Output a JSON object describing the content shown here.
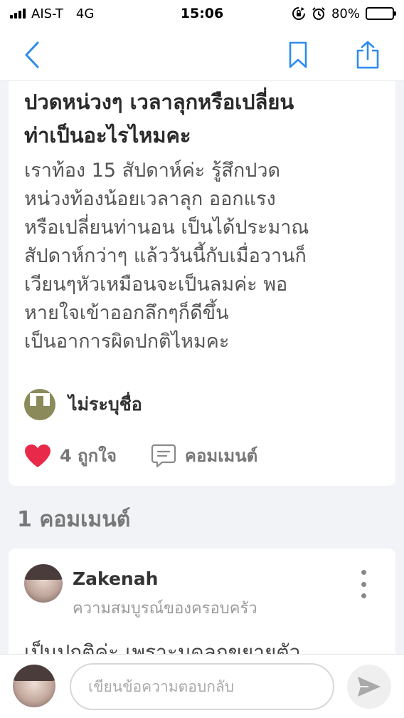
{
  "status_bar": {
    "carrier": "AIS-T",
    "network": "4G",
    "time": "15:06",
    "battery": "80%",
    "icons": [
      "signal-bars-icon",
      "rotation-lock-icon",
      "alarm-clock-icon",
      "battery-icon"
    ]
  },
  "nav": {
    "icons": [
      "chevron-left-icon",
      "bookmark-icon",
      "share-icon"
    ],
    "accent_color": "#2d8cf0"
  },
  "post": {
    "title_lines": [
      "ปวดหน่วงๆ เวลาลุกหรือเปลี่ยน",
      "ท่าเป็นอะไรไหมคะ"
    ],
    "body_lines": [
      "เราท้อง 15 สัปดาห์ค่ะ รู้สึกปวด",
      "หน่วงท้องน้อยเวลาลุก ออกแรง",
      "หรือเปลี่ยนท่านอน เป็นได้ประมาณ",
      "สัปดาห์กว่าๆ แล้ววันนี้กับเมื่อวานก็",
      "เวียนๆหัวเหมือนจะเป็นลมค่ะ พอ",
      "หายใจเข้าออกลึกๆก็ดีขึ้น",
      "เป็นอาการผิดปกติไหมคะ"
    ],
    "author": "ไม่ระบุชื่อ",
    "likes_label": "4 ถูกใจ",
    "comment_label": "คอมเมนต์",
    "like_color": "#e8294a"
  },
  "comments": {
    "count_label": "1 คอมเมนต์",
    "items": [
      {
        "name": "Zakenah",
        "subtitle": "ความสมบูรณ์ของครอบครัว",
        "text": "เป็นปกติค่ะ เพราะมดลูกขยายตัว"
      }
    ]
  },
  "reply": {
    "placeholder": "เขียนข้อความตอบกลับ"
  }
}
